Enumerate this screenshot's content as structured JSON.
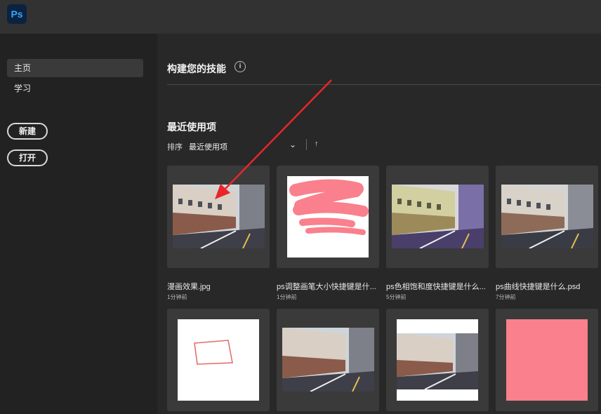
{
  "app": {
    "logo": "Ps"
  },
  "sidebar": {
    "items": [
      {
        "label": "主页",
        "active": true
      },
      {
        "label": "学习",
        "active": false
      }
    ],
    "new_button": "新建",
    "open_button": "打开"
  },
  "main": {
    "skills_title": "构建您的技能",
    "recent_title": "最近使用项",
    "sort_label": "排序",
    "sort_value": "最近使用项",
    "files": [
      {
        "name": "漫画效果.jpg",
        "time": "1分钟前",
        "thumb": "street"
      },
      {
        "name": "ps调整画笔大小快捷键是什...",
        "time": "1分钟前",
        "thumb": "pink-strokes"
      },
      {
        "name": "ps色相饱和度快捷键是什么...",
        "time": "5分钟前",
        "thumb": "street-tinted"
      },
      {
        "name": "ps曲线快捷键是什么.psd",
        "time": "7分钟前",
        "thumb": "street"
      },
      {
        "name": "",
        "time": "",
        "thumb": "red-outline"
      },
      {
        "name": "",
        "time": "",
        "thumb": "street"
      },
      {
        "name": "",
        "time": "",
        "thumb": "street"
      },
      {
        "name": "",
        "time": "",
        "thumb": "pink-fill"
      }
    ]
  },
  "colors": {
    "accent_pink": "#f9808c",
    "annotation_red": "#e8262a",
    "ps_blue": "#31a8ff"
  }
}
